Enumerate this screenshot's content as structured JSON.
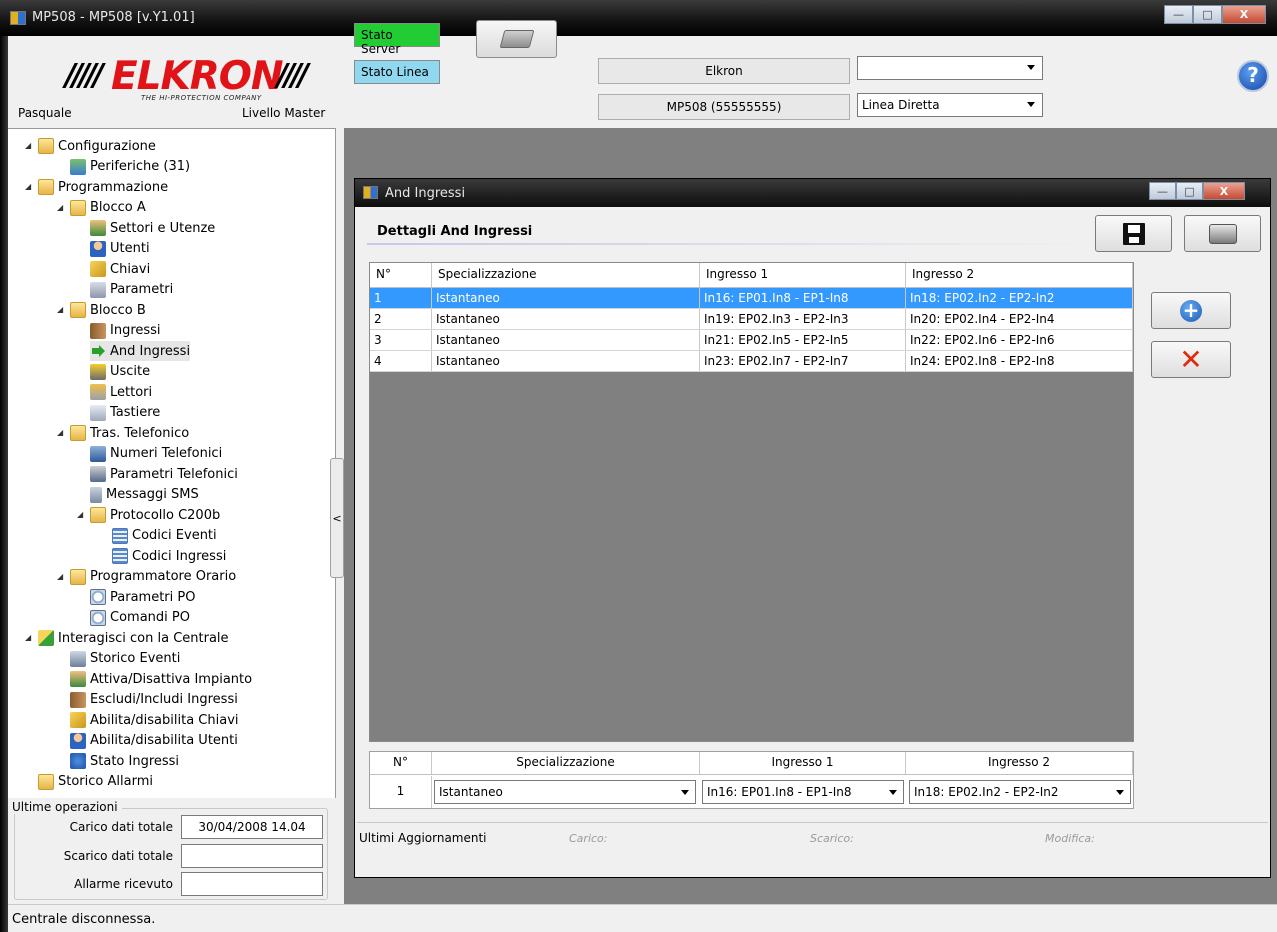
{
  "window": {
    "title": "MP508 - MP508 [v.Y1.01]"
  },
  "header": {
    "logo_text": "ELKRON",
    "logo_tagline": "THE HI-PROTECTION COMPANY",
    "user_name": "Pasquale",
    "user_level": "Livello Master",
    "stato_server": "Stato Server",
    "stato_linea": "Stato Linea",
    "info_name": "Elkron",
    "info_device": "MP508 (55555555)",
    "combo_top_value": "",
    "combo_line_value": "Linea Diretta",
    "help": "?"
  },
  "tree": {
    "items": [
      {
        "label": "Configurazione",
        "icon": "folder-icon"
      },
      {
        "label": "Periferiche (31)",
        "icon": "network-icon"
      },
      {
        "label": "Programmazione",
        "icon": "folder-icon"
      },
      {
        "label": "Blocco A",
        "icon": "folder-icon"
      },
      {
        "label": "Settori e Utenze",
        "icon": "house-icon"
      },
      {
        "label": "Utenti",
        "icon": "user-icon"
      },
      {
        "label": "Chiavi",
        "icon": "key-icon"
      },
      {
        "label": "Parametri",
        "icon": "parameters-icon"
      },
      {
        "label": "Blocco B",
        "icon": "folder-icon"
      },
      {
        "label": "Ingressi",
        "icon": "door-icon"
      },
      {
        "label": "And Ingressi",
        "icon": "arrow-right-icon"
      },
      {
        "label": "Uscite",
        "icon": "speaker-icon"
      },
      {
        "label": "Lettori",
        "icon": "reader-icon"
      },
      {
        "label": "Tastiere",
        "icon": "keyboard-icon"
      },
      {
        "label": "Tras. Telefonico",
        "icon": "folder-icon"
      },
      {
        "label": "Numeri Telefonici",
        "icon": "phone-icon"
      },
      {
        "label": "Parametri Telefonici",
        "icon": "phone-settings-icon"
      },
      {
        "label": "Messaggi SMS",
        "icon": "mobile-icon"
      },
      {
        "label": "Protocollo C200b",
        "icon": "folder-icon"
      },
      {
        "label": "Codici Eventi",
        "icon": "document-icon"
      },
      {
        "label": "Codici Ingressi",
        "icon": "document-icon"
      },
      {
        "label": "Programmatore Orario",
        "icon": "folder-icon"
      },
      {
        "label": "Parametri PO",
        "icon": "clock-icon"
      },
      {
        "label": "Comandi PO",
        "icon": "clock-icon"
      },
      {
        "label": "Interagisci con la Centrale",
        "icon": "folder-arrow-icon"
      },
      {
        "label": "Storico Eventi",
        "icon": "monitor-icon"
      },
      {
        "label": "Attiva/Disattiva Impianto",
        "icon": "house-icon"
      },
      {
        "label": "Escludi/Includi Ingressi",
        "icon": "door-icon"
      },
      {
        "label": "Abilita/disabilita Chiavi",
        "icon": "key-icon"
      },
      {
        "label": "Abilita/disabilita Utenti",
        "icon": "user-icon"
      },
      {
        "label": "Stato Ingressi",
        "icon": "info-icon"
      },
      {
        "label": "Storico Allarmi",
        "icon": "folder-icon"
      }
    ]
  },
  "ops": {
    "title": "Ultime operazioni",
    "carico_label": "Carico dati totale",
    "carico_value": "30/04/2008 14.04",
    "scarico_label": "Scarico dati totale",
    "scarico_value": "",
    "allarme_label": "Allarme ricevuto",
    "allarme_value": ""
  },
  "collapse_label": "<",
  "child": {
    "title": "And Ingressi",
    "section_title": "Dettagli And Ingressi",
    "columns": [
      "N°",
      "Specializzazione",
      "Ingresso 1",
      "Ingresso 2"
    ],
    "rows": [
      [
        "1",
        "Istantaneo",
        "In16: EP01.In8 - EP1-In8",
        "In18: EP02.In2 - EP2-In2"
      ],
      [
        "2",
        "Istantaneo",
        "In19: EP02.In3 - EP2-In3",
        "In20: EP02.In4 - EP2-In4"
      ],
      [
        "3",
        "Istantaneo",
        "In21: EP02.In5 - EP2-In5",
        "In22: EP02.In6 - EP2-In6"
      ],
      [
        "4",
        "Istantaneo",
        "In23: EP02.In7 - EP2-In7",
        "In24: EP02.In8 - EP2-In8"
      ]
    ],
    "selected_row": 1,
    "edit": {
      "num": "1",
      "specializzazione": "Istantaneo",
      "ingresso1": "In16: EP01.In8 - EP1-In8",
      "ingresso2": "In18: EP02.In2 - EP2-In2"
    },
    "footer_label": "Ultimi Aggiornamenti",
    "carico": "Carico:",
    "scarico": "Scarico:",
    "modifica": "Modifica:"
  },
  "statusbar": {
    "text": "Centrale disconnessa."
  }
}
